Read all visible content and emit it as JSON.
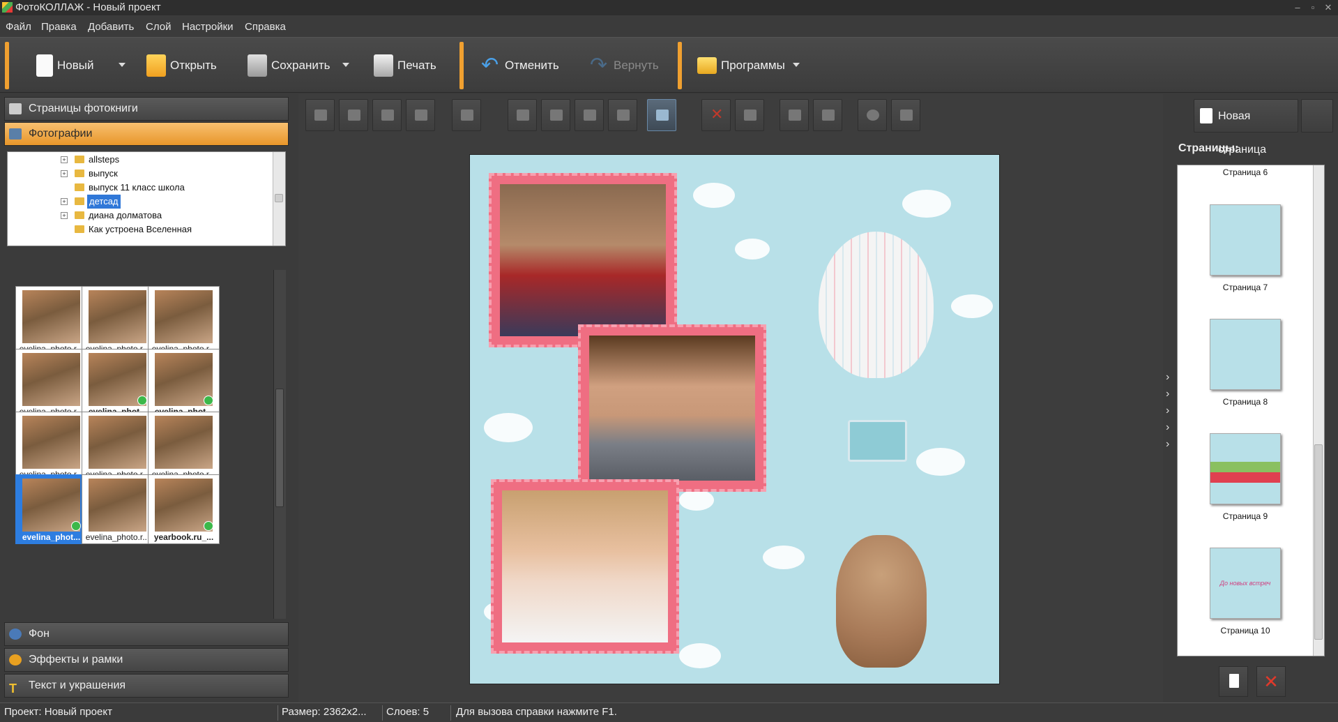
{
  "window": {
    "title": "ФотоКОЛЛАЖ - Новый проект"
  },
  "menu": [
    "Файл",
    "Правка",
    "Добавить",
    "Слой",
    "Настройки",
    "Справка"
  ],
  "toolbar": {
    "new_label": "Новый",
    "open_label": "Открыть",
    "save_label": "Сохранить",
    "print_label": "Печать",
    "undo_label": "Отменить",
    "redo_label": "Вернуть",
    "programs_label": "Программы"
  },
  "left_panel": {
    "book_pages_label": "Страницы фотокниги",
    "photos_label": "Фотографии",
    "tree": [
      "allsteps",
      "выпуск",
      "выпуск 11 класс школа",
      "детсад",
      "диана долматова",
      "Как устроена Вселенная"
    ],
    "tree_selected": "детсад",
    "thumbnails": [
      {
        "name": "evelina_photo.r...",
        "bold": false,
        "check": false
      },
      {
        "name": "evelina_photo.r...",
        "bold": false,
        "check": false
      },
      {
        "name": "evelina_photo.r...",
        "bold": false,
        "check": false
      },
      {
        "name": "evelina_photo.r...",
        "bold": false,
        "check": false
      },
      {
        "name": "evelina_phot...",
        "bold": true,
        "check": true
      },
      {
        "name": "evelina_phot...",
        "bold": true,
        "check": true
      },
      {
        "name": "evelina_photo.r...",
        "bold": false,
        "check": false
      },
      {
        "name": "evelina_photo.r...",
        "bold": false,
        "check": false
      },
      {
        "name": "evelina_photo.r...",
        "bold": false,
        "check": false
      },
      {
        "name": "evelina_phot...",
        "bold": true,
        "check": true,
        "selected": true
      },
      {
        "name": "evelina_photo.r...",
        "bold": false,
        "check": false
      },
      {
        "name": "yearbook.ru_...",
        "bold": true,
        "check": true
      }
    ],
    "background_label": "Фон",
    "effects_label": "Эффекты и рамки",
    "text_label": "Текст и украшения"
  },
  "right_panel": {
    "new_page_label": "Новая страница",
    "pages_title": "Страницы:",
    "pages": [
      "Страница 6",
      "Страница 7",
      "Страница 8",
      "Страница 9",
      "Страница 10"
    ],
    "page10_text": "До новых встреч"
  },
  "status": {
    "project": "Проект:  Новый проект",
    "size": "Размер:  2362x2...",
    "layers": "Слоев:  5",
    "hint": "Для вызова справки нажмите F1."
  },
  "colors": {
    "accent": "#f0a030",
    "frame_pink": "#ef6e82",
    "canvas_bg": "#b8e0e8",
    "selection": "#2d7de0"
  }
}
